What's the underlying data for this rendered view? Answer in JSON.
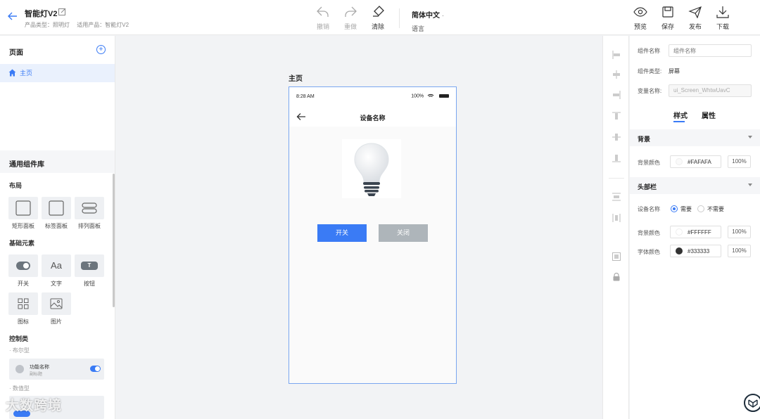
{
  "header": {
    "title": "智能灯V2",
    "product_type": "产品类型：照明灯",
    "applicable_product": "适用产品：智能灯V2",
    "toolbar": {
      "undo": "撤销",
      "redo": "重做",
      "clear": "清除",
      "language_value": "简体中文",
      "language_label": "语言",
      "preview": "预览",
      "save": "保存",
      "publish": "发布",
      "download": "下载"
    }
  },
  "pages_panel": {
    "title": "页面",
    "items": [
      {
        "label": "主页"
      }
    ]
  },
  "library": {
    "title": "通用组件库",
    "layout_section": "布局",
    "layout_items": [
      {
        "label": "矩形面板"
      },
      {
        "label": "标签面板"
      },
      {
        "label": "排列面板"
      }
    ],
    "basic_section": "基础元素",
    "basic_items": [
      {
        "label": "开关"
      },
      {
        "label": "文字"
      },
      {
        "label": "按钮"
      },
      {
        "label": "图标"
      },
      {
        "label": "图片"
      }
    ],
    "basic_glyph_text": "Aa",
    "basic_glyph_button": "T",
    "control_section": "控制类",
    "bool_type": "· 布尔型",
    "bool_card_title": "功能名称",
    "bool_card_sub": "副标题",
    "numeric_type": "· 数值型"
  },
  "canvas": {
    "screen_label": "主页",
    "phone": {
      "time": "8:28 AM",
      "battery": "100%",
      "nav_title": "设备名称",
      "btn_on": "开关",
      "btn_off": "关闭"
    }
  },
  "properties": {
    "component_name_label": "组件名称",
    "component_name_placeholder": "组件名称",
    "component_type_label": "组件类型:",
    "component_type_value": "屏幕",
    "variable_name_label": "变量名称:",
    "variable_name_value": "ui_Screen_WhtwUavC",
    "tab_style": "样式",
    "tab_attr": "属性",
    "bg_group": "背景",
    "bg_color_label": "背景颜色",
    "bg_color_value": "#FAFAFA",
    "bg_opacity": "100%",
    "header_group": "头部栏",
    "device_name_label": "设备名称",
    "radio_need": "需要",
    "radio_not_need": "不需要",
    "header_bg_label": "背景颜色",
    "header_bg_value": "#FFFFFF",
    "header_bg_opacity": "100%",
    "font_color_label": "字体颜色",
    "font_color_value": "#333333",
    "font_color_opacity": "100%"
  },
  "watermark": "大数跨境",
  "colors": {
    "accent": "#3a7bf5",
    "off_button": "#aeb5ba"
  }
}
